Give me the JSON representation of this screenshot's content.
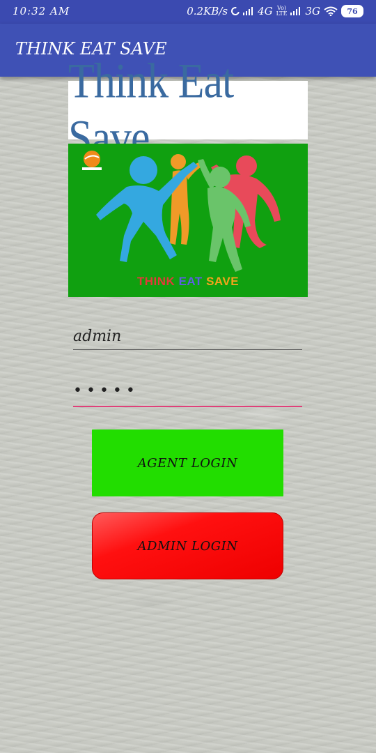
{
  "status_bar": {
    "time": "10:32 AM",
    "network_speed": "0.2KB/s",
    "network_4g": "4G",
    "volte_line1": "Vo)",
    "volte_line2": "LTE",
    "network_3g": "3G",
    "battery": "76"
  },
  "app_bar": {
    "title": "THINK EAT SAVE"
  },
  "logo": {
    "text": "Think Eat Save"
  },
  "picture": {
    "caption_think": "THINK",
    "caption_eat": "EAT",
    "caption_save": "SAVE"
  },
  "form": {
    "username_value": "admin",
    "password_mask": "•••••"
  },
  "buttons": {
    "agent_login": "AGENT LOGIN",
    "admin_login": "ADMIN LOGIN"
  },
  "colors": {
    "app_bar": "#3f51b5",
    "agent_button": "#22dd00",
    "admin_button": "#ff1010",
    "password_underline": "#e0407a"
  }
}
